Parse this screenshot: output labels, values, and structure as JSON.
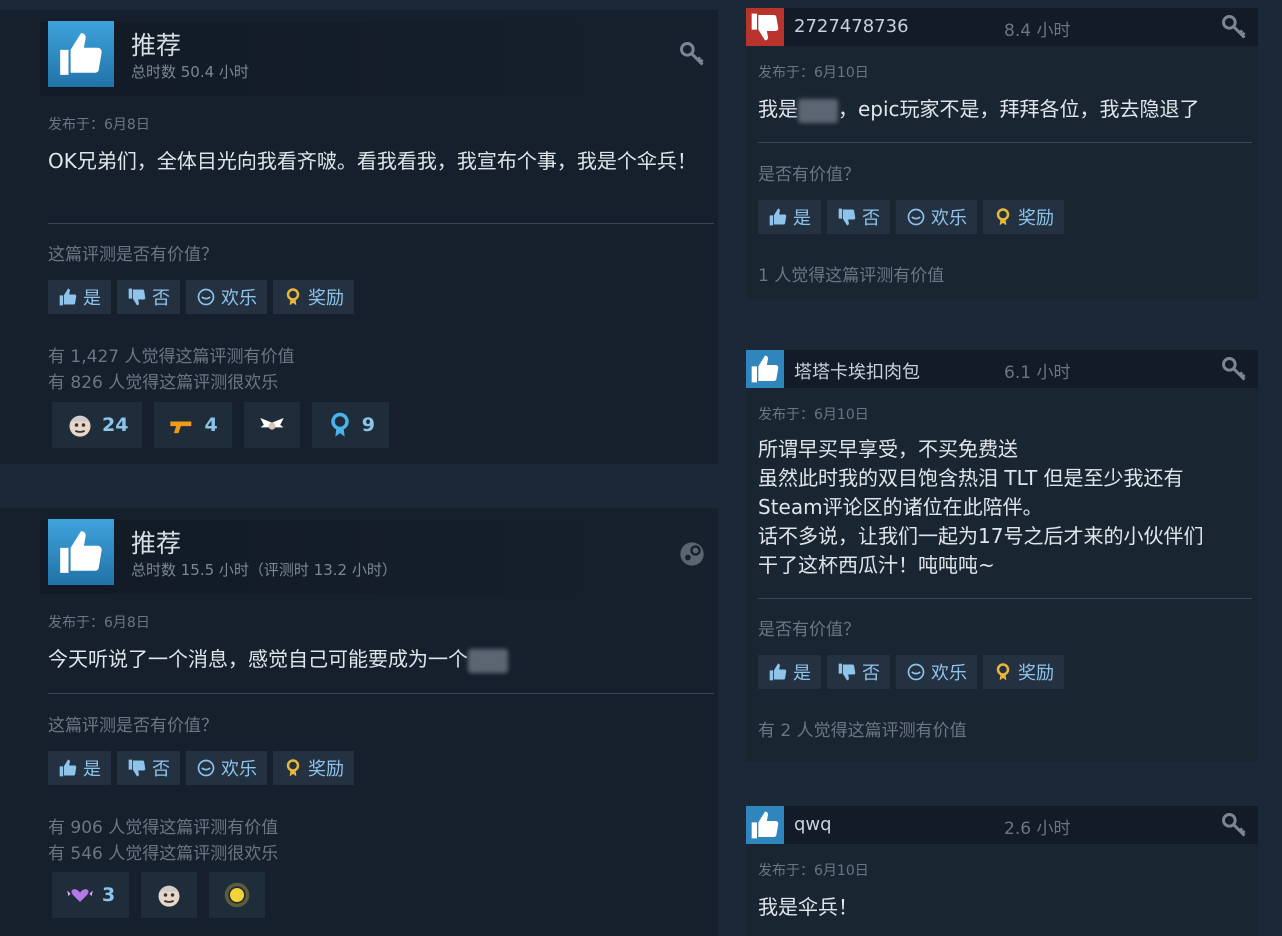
{
  "left_reviews": [
    {
      "recommend": "推荐",
      "hours": "总时数 50.4 小时",
      "posted": "发布于：6月8日",
      "text": "OK兄弟们，全体目光向我看齐啵。看我看我，我宣布个事，我是个伞兵！",
      "question": "这篇评测是否有价值？",
      "buttons": {
        "yes": "是",
        "no": "否",
        "funny": "欢乐",
        "award": "奖励"
      },
      "helpful": "有 1,427 人觉得这篇评测有价值",
      "funny": "有 826 人觉得这篇评测很欢乐",
      "awards": [
        {
          "icon": "face-icon",
          "count": "24"
        },
        {
          "icon": "gun-icon",
          "count": "4"
        },
        {
          "icon": "wings-icon",
          "count": ""
        },
        {
          "icon": "ribbon-icon",
          "count": "9"
        }
      ]
    },
    {
      "recommend": "推荐",
      "hours": "总时数 15.5 小时（评测时 13.2 小时）",
      "posted": "发布于：6月8日",
      "text": "今天听说了一个消息，感觉自己可能要成为一个",
      "question": "这篇评测是否有价值？",
      "buttons": {
        "yes": "是",
        "no": "否",
        "funny": "欢乐",
        "award": "奖励"
      },
      "helpful": "有 906 人觉得这篇评测有价值",
      "funny": "有 546 人觉得这篇评测很欢乐",
      "awards": [
        {
          "icon": "heart-wings-icon",
          "count": "3"
        },
        {
          "icon": "face-icon",
          "count": ""
        },
        {
          "icon": "orb-icon",
          "count": ""
        }
      ]
    }
  ],
  "right_reviews": [
    {
      "vote": "not-recommended",
      "name": "2727478736",
      "hours": "8.4 小时",
      "posted": "发布于：6月10日",
      "text_before": "我是",
      "text_after": "，epic玩家不是，拜拜各位，我去隐退了",
      "question": "是否有价值？",
      "buttons": {
        "yes": "是",
        "no": "否",
        "funny": "欢乐",
        "award": "奖励"
      },
      "helpful": "1 人觉得这篇评测有价值"
    },
    {
      "vote": "recommended",
      "name": "塔塔卡埃扣肉包",
      "hours": "6.1 小时",
      "posted": "发布于：6月10日",
      "text_lines": [
        "所谓早买早享受，不买免费送",
        "虽然此时我的双目饱含热泪 TLT 但是至少我还有",
        "Steam评论区的诸位在此陪伴。",
        "话不多说，让我们一起为17号之后才来的小伙伴们",
        "干了这杯西瓜汁！吨吨吨~"
      ],
      "question": "是否有价值？",
      "buttons": {
        "yes": "是",
        "no": "否",
        "funny": "欢乐",
        "award": "奖励"
      },
      "helpful": "有 2 人觉得这篇评测有价值"
    },
    {
      "vote": "recommended",
      "name": "qwq",
      "hours": "2.6 小时",
      "posted": "发布于：6月10日",
      "text": "我是伞兵！"
    }
  ],
  "colors": {
    "background": "#1b2838",
    "accent": "#8ec3ea",
    "thumb_up": "#3fa3db",
    "thumb_down": "#c23a32",
    "award_gold": "#e7b83a"
  }
}
